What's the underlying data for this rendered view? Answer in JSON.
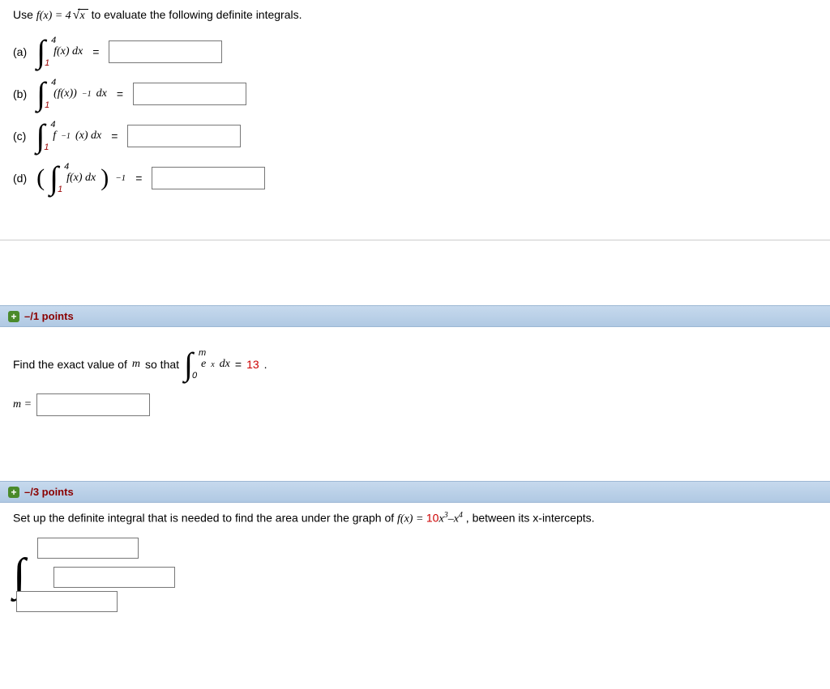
{
  "q1": {
    "prompt_prefix": "Use ",
    "prompt_fx": "f(x) = 4",
    "prompt_sqrt": "x",
    "prompt_suffix": "  to evaluate the following definite integrals.",
    "parts": {
      "a": {
        "label": "(a)",
        "upper": "4",
        "lower": "1",
        "integrand": "f(x) dx",
        "eq": "="
      },
      "b": {
        "label": "(b)",
        "upper": "4",
        "lower": "1",
        "integrand_pre": "(f(x))",
        "integrand_exp": "−1",
        "integrand_post": " dx",
        "eq": "="
      },
      "c": {
        "label": "(c)",
        "upper": "4",
        "lower": "1",
        "integrand_pre": "f",
        "integrand_exp": "−1",
        "integrand_post": "(x) dx",
        "eq": "="
      },
      "d": {
        "label": "(d)",
        "upper": "4",
        "lower": "1",
        "integrand": "f(x) dx",
        "outer_exp": "−1",
        "eq": "="
      }
    }
  },
  "q2": {
    "points": "–/1 points",
    "text_prefix": "Find the exact value of ",
    "text_var": "m",
    "text_mid": " so that ",
    "int_upper": "m",
    "int_lower": "0",
    "integrand_base": "e",
    "integrand_exp": "x",
    "integrand_post": " dx",
    "eq": "=",
    "rhs": "13",
    "period": " .",
    "answer_label": "m ="
  },
  "q3": {
    "points": "–/3 points",
    "text_prefix": "Set up the definite integral that is needed to find the area under the graph of  ",
    "fx_lhs": "f(x) = ",
    "fx_term1_coef": "10",
    "fx_term1_var": "x",
    "fx_term1_exp": "3",
    "fx_minus": "–",
    "fx_term2_var": "x",
    "fx_term2_exp": "4",
    "text_suffix": " , between its x-intercepts."
  }
}
